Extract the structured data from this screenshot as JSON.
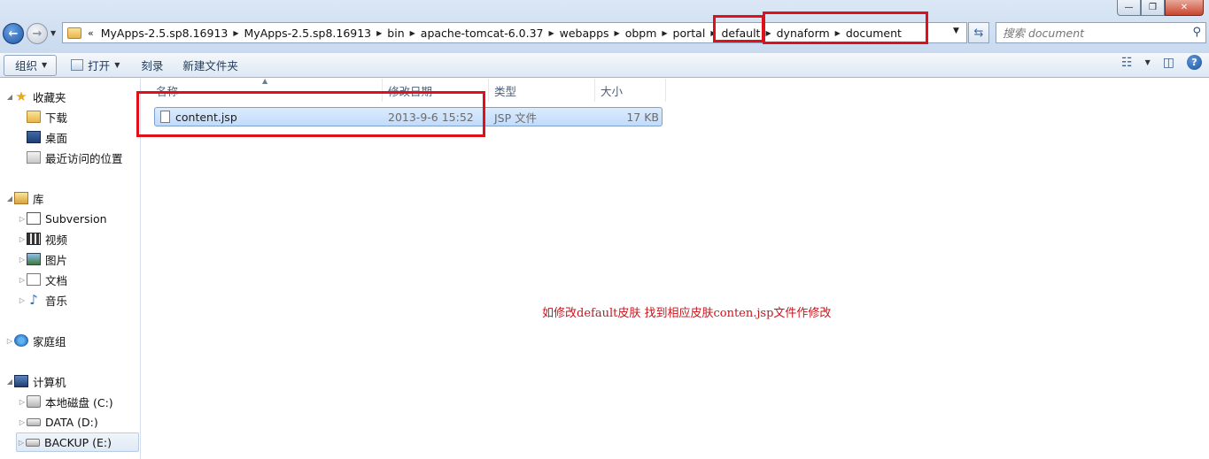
{
  "window": {
    "minimize": "—",
    "maximize": "❐",
    "close": "✕"
  },
  "nav": {
    "back_glyph": "←",
    "forward_glyph": "→"
  },
  "address": {
    "overflow": "«",
    "crumbs": [
      "MyApps-2.5.sp8.16913",
      "MyApps-2.5.sp8.16913",
      "bin",
      "apache-tomcat-6.0.37",
      "webapps",
      "obpm",
      "portal",
      "default",
      "dynaform",
      "document"
    ]
  },
  "search": {
    "placeholder": "搜索 document"
  },
  "toolbar": {
    "organize": "组织",
    "open": "打开",
    "burn": "刻录",
    "new_folder": "新建文件夹"
  },
  "sidebar": {
    "favorites": "收藏夹",
    "downloads": "下载",
    "desktop": "桌面",
    "recent": "最近访问的位置",
    "libraries": "库",
    "subversion": "Subversion",
    "videos": "视频",
    "pictures": "图片",
    "documents": "文档",
    "music": "音乐",
    "homegroup": "家庭组",
    "computer": "计算机",
    "drive_c": "本地磁盘 (C:)",
    "drive_d": "DATA (D:)",
    "drive_e": "BACKUP (E:)"
  },
  "columns": {
    "name": "名称",
    "modified": "修改日期",
    "type": "类型",
    "size": "大小"
  },
  "file": {
    "name": "content.jsp",
    "modified": "2013-9-6 15:52",
    "type": "JSP 文件",
    "size": "17 KB"
  },
  "annotation": "如修改default皮肤 找到相应皮肤conten.jsp文件作修改",
  "colors": {
    "annotation_red": "#e0101a",
    "selection": "#c1dbfc"
  }
}
